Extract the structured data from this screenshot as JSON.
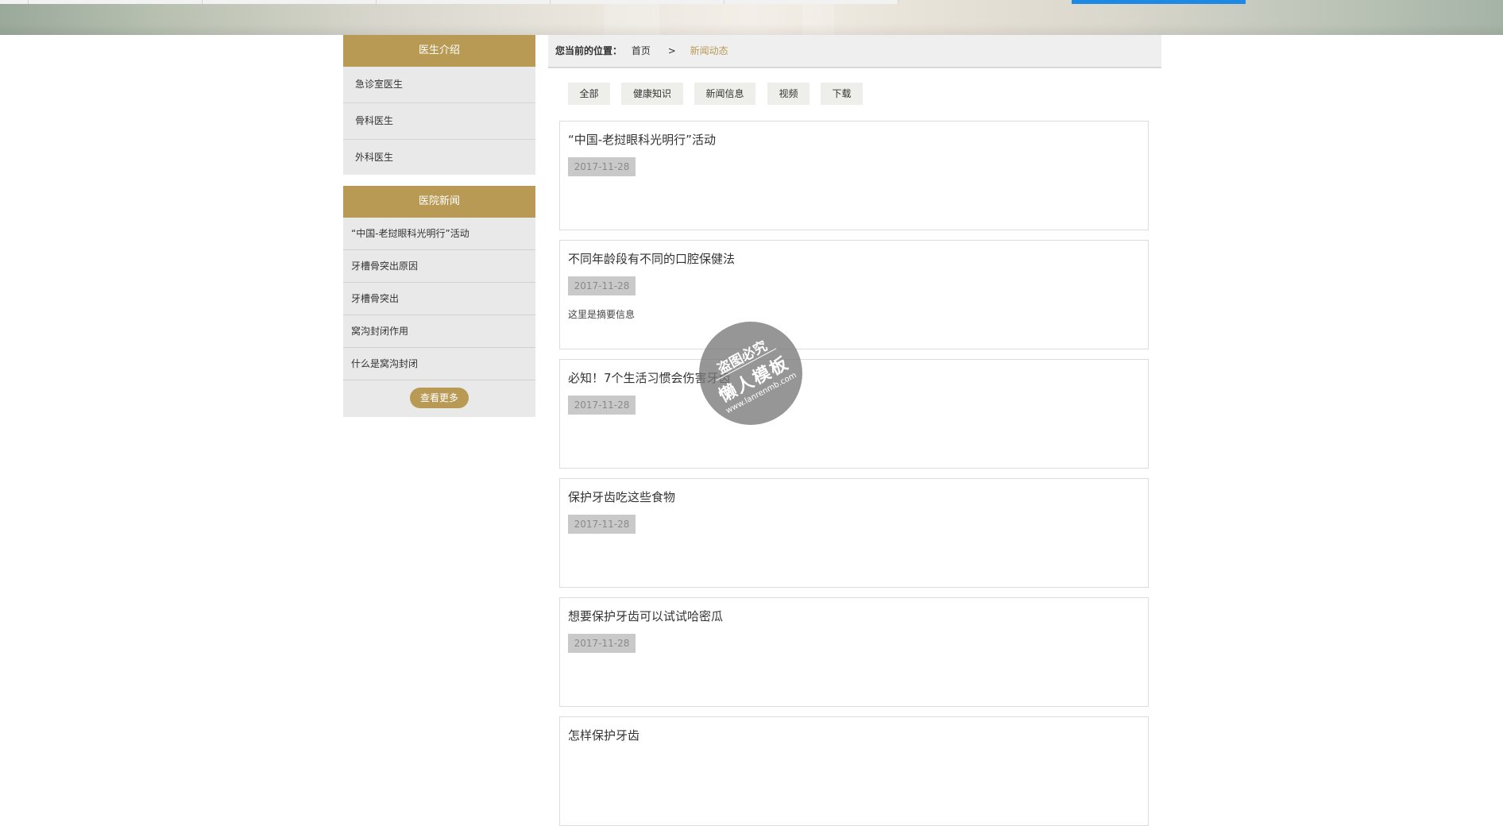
{
  "sidebar": {
    "doctors_title": "医生介绍",
    "doctors": [
      {
        "label": "急诊室医生"
      },
      {
        "label": "骨科医生"
      },
      {
        "label": "外科医生"
      }
    ],
    "news_title": "医院新闻",
    "news": [
      {
        "label": "“中国-老挝眼科光明行”活动"
      },
      {
        "label": "牙槽骨突出原因"
      },
      {
        "label": "牙槽骨突出"
      },
      {
        "label": "窝沟封闭作用"
      },
      {
        "label": "什么是窝沟封闭"
      }
    ],
    "more_label": "查看更多"
  },
  "breadcrumb": {
    "label": "您当前的位置：",
    "home": "首页",
    "separator": ">",
    "current": "新闻动态"
  },
  "tabs": [
    {
      "label": "全部"
    },
    {
      "label": "健康知识"
    },
    {
      "label": "新闻信息"
    },
    {
      "label": "视频"
    },
    {
      "label": "下载"
    }
  ],
  "articles": [
    {
      "title": "“中国-老挝眼科光明行”活动",
      "date": "2017-11-28",
      "summary": ""
    },
    {
      "title": "不同年龄段有不同的口腔保健法",
      "date": "2017-11-28",
      "summary": "这里是摘要信息"
    },
    {
      "title": "必知！7个生活习惯会伤害牙齿",
      "date": "2017-11-28",
      "summary": ""
    },
    {
      "title": "保护牙齿吃这些食物",
      "date": "2017-11-28",
      "summary": ""
    },
    {
      "title": "想要保护牙齿可以试试哈密瓜",
      "date": "2017-11-28",
      "summary": ""
    },
    {
      "title": "怎样保护牙齿",
      "date": "",
      "summary": ""
    }
  ],
  "watermark": {
    "line1": "盗图必究",
    "line2": "懒人模板",
    "line3": "www.lanrenmb.com"
  },
  "colors": {
    "accent": "#b89a55",
    "nav_active": "#1e88e5",
    "sidebar_bg": "#e9e9e9",
    "date_badge": "#c9c9c9"
  }
}
